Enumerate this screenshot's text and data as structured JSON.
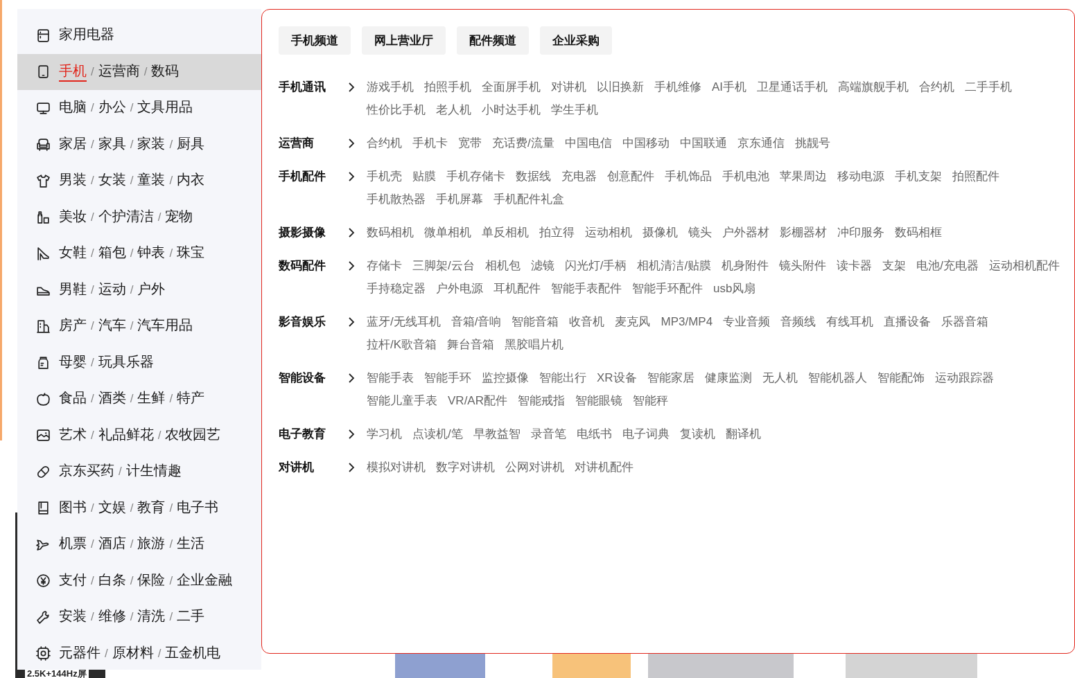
{
  "sidebar": {
    "items": [
      {
        "links": [
          {
            "text": "家用电器",
            "active": false
          }
        ],
        "selected": false
      },
      {
        "links": [
          {
            "text": "手机",
            "active": true
          },
          {
            "text": "运营商",
            "active": false
          },
          {
            "text": "数码",
            "active": false
          }
        ],
        "separators": [
          "/",
          "/"
        ],
        "selected": true
      },
      {
        "links": [
          {
            "text": "电脑",
            "active": false
          },
          {
            "text": "办公",
            "active": false
          },
          {
            "text": "文具用品",
            "active": false
          }
        ],
        "separators": [
          "/",
          "/"
        ],
        "selected": false
      },
      {
        "links": [
          {
            "text": "家居",
            "active": false
          },
          {
            "text": "家具",
            "active": false
          },
          {
            "text": "家装",
            "active": false
          },
          {
            "text": "厨具",
            "active": false
          }
        ],
        "separators": [
          "/",
          "/",
          "/"
        ],
        "selected": false
      },
      {
        "links": [
          {
            "text": "男装",
            "active": false
          },
          {
            "text": "女装",
            "active": false
          },
          {
            "text": "童装",
            "active": false
          },
          {
            "text": "内衣",
            "active": false
          }
        ],
        "separators": [
          "/",
          "/",
          "/"
        ],
        "selected": false
      },
      {
        "links": [
          {
            "text": "美妆",
            "active": false
          },
          {
            "text": "个护清洁",
            "active": false
          },
          {
            "text": "宠物",
            "active": false
          }
        ],
        "separators": [
          "/",
          "/"
        ],
        "selected": false
      },
      {
        "links": [
          {
            "text": "女鞋",
            "active": false
          },
          {
            "text": "箱包",
            "active": false
          },
          {
            "text": "钟表",
            "active": false
          },
          {
            "text": "珠宝",
            "active": false
          }
        ],
        "separators": [
          "/",
          "/",
          "/"
        ],
        "selected": false
      },
      {
        "links": [
          {
            "text": "男鞋",
            "active": false
          },
          {
            "text": "运动",
            "active": false
          },
          {
            "text": "户外",
            "active": false
          }
        ],
        "separators": [
          "/",
          "/"
        ],
        "selected": false
      },
      {
        "links": [
          {
            "text": "房产",
            "active": false
          },
          {
            "text": "汽车",
            "active": false
          },
          {
            "text": "汽车用品",
            "active": false
          }
        ],
        "separators": [
          "/",
          "/"
        ],
        "selected": false
      },
      {
        "links": [
          {
            "text": "母婴",
            "active": false
          },
          {
            "text": "玩具乐器",
            "active": false
          }
        ],
        "separators": [
          "/"
        ],
        "selected": false
      },
      {
        "links": [
          {
            "text": "食品",
            "active": false
          },
          {
            "text": "酒类",
            "active": false
          },
          {
            "text": "生鲜",
            "active": false
          },
          {
            "text": "特产",
            "active": false
          }
        ],
        "separators": [
          "/",
          "/",
          "/"
        ],
        "selected": false
      },
      {
        "links": [
          {
            "text": "艺术",
            "active": false
          },
          {
            "text": "礼品鲜花",
            "active": false
          },
          {
            "text": "农牧园艺",
            "active": false
          }
        ],
        "separators": [
          "/",
          "/"
        ],
        "selected": false
      },
      {
        "links": [
          {
            "text": "京东买药",
            "active": false
          },
          {
            "text": "计生情趣",
            "active": false
          }
        ],
        "separators": [
          "/"
        ],
        "selected": false
      },
      {
        "links": [
          {
            "text": "图书",
            "active": false
          },
          {
            "text": "文娱",
            "active": false
          },
          {
            "text": "教育",
            "active": false
          },
          {
            "text": "电子书",
            "active": false
          }
        ],
        "separators": [
          "/",
          "/",
          "/"
        ],
        "selected": false
      },
      {
        "links": [
          {
            "text": "机票",
            "active": false
          },
          {
            "text": "酒店",
            "active": false
          },
          {
            "text": "旅游",
            "active": false
          },
          {
            "text": "生活",
            "active": false
          }
        ],
        "separators": [
          "/",
          "/",
          "/"
        ],
        "selected": false
      },
      {
        "links": [
          {
            "text": "支付",
            "active": false
          },
          {
            "text": "白条",
            "active": false
          },
          {
            "text": "保险",
            "active": false
          },
          {
            "text": "企业金融",
            "active": false
          }
        ],
        "separators": [
          "/",
          "/",
          "/"
        ],
        "selected": false
      },
      {
        "links": [
          {
            "text": "安装",
            "active": false
          },
          {
            "text": "维修",
            "active": false
          },
          {
            "text": "清洗",
            "active": false
          },
          {
            "text": "二手",
            "active": false
          }
        ],
        "separators": [
          "/",
          "/",
          "/"
        ],
        "selected": false
      },
      {
        "links": [
          {
            "text": "元器件",
            "active": false
          },
          {
            "text": "原材料",
            "active": false
          },
          {
            "text": "五金机电",
            "active": false
          }
        ],
        "separators": [
          "/",
          "/"
        ],
        "selected": false
      }
    ]
  },
  "panel": {
    "tabs": [
      "手机频道",
      "网上营业厅",
      "配件频道",
      "企业采购"
    ],
    "categories": [
      {
        "title": "手机通讯",
        "links": [
          "游戏手机",
          "拍照手机",
          "全面屏手机",
          "对讲机",
          "以旧换新",
          "手机维修",
          "AI手机",
          "卫星通话手机",
          "高端旗舰手机",
          "合约机",
          "二手手机",
          "性价比手机",
          "老人机",
          "小时达手机",
          "学生手机"
        ]
      },
      {
        "title": "运营商",
        "links": [
          "合约机",
          "手机卡",
          "宽带",
          "充话费/流量",
          "中国电信",
          "中国移动",
          "中国联通",
          "京东通信",
          "挑靓号"
        ]
      },
      {
        "title": "手机配件",
        "links": [
          "手机壳",
          "贴膜",
          "手机存储卡",
          "数据线",
          "充电器",
          "创意配件",
          "手机饰品",
          "手机电池",
          "苹果周边",
          "移动电源",
          "手机支架",
          "拍照配件",
          "手机散热器",
          "手机屏幕",
          "手机配件礼盒"
        ]
      },
      {
        "title": "摄影摄像",
        "links": [
          "数码相机",
          "微单相机",
          "单反相机",
          "拍立得",
          "运动相机",
          "摄像机",
          "镜头",
          "户外器材",
          "影棚器材",
          "冲印服务",
          "数码相框"
        ]
      },
      {
        "title": "数码配件",
        "links": [
          "存储卡",
          "三脚架/云台",
          "相机包",
          "滤镜",
          "闪光灯/手柄",
          "相机清洁/贴膜",
          "机身附件",
          "镜头附件",
          "读卡器",
          "支架",
          "电池/充电器",
          "运动相机配件",
          "手持稳定器",
          "户外电源",
          "耳机配件",
          "智能手表配件",
          "智能手环配件",
          "usb风扇"
        ]
      },
      {
        "title": "影音娱乐",
        "links": [
          "蓝牙/无线耳机",
          "音箱/音响",
          "智能音箱",
          "收音机",
          "麦克风",
          "MP3/MP4",
          "专业音频",
          "音频线",
          "有线耳机",
          "直播设备",
          "乐器音箱",
          "拉杆/K歌音箱",
          "舞台音箱",
          "黑胶唱片机"
        ]
      },
      {
        "title": "智能设备",
        "links": [
          "智能手表",
          "智能手环",
          "监控摄像",
          "智能出行",
          "XR设备",
          "智能家居",
          "健康监测",
          "无人机",
          "智能机器人",
          "智能配饰",
          "运动跟踪器",
          "智能儿童手表",
          "VR/AR配件",
          "智能戒指",
          "智能眼镜",
          "智能秤"
        ]
      },
      {
        "title": "电子教育",
        "links": [
          "学习机",
          "点读机/笔",
          "早教益智",
          "录音笔",
          "电纸书",
          "电子词典",
          "复读机",
          "翻译机"
        ]
      },
      {
        "title": "对讲机",
        "links": [
          "模拟对讲机",
          "数字对讲机",
          "公网对讲机",
          "对讲机配件"
        ]
      }
    ]
  },
  "background": {
    "product_tag": "2.5K+144Hz屏"
  }
}
